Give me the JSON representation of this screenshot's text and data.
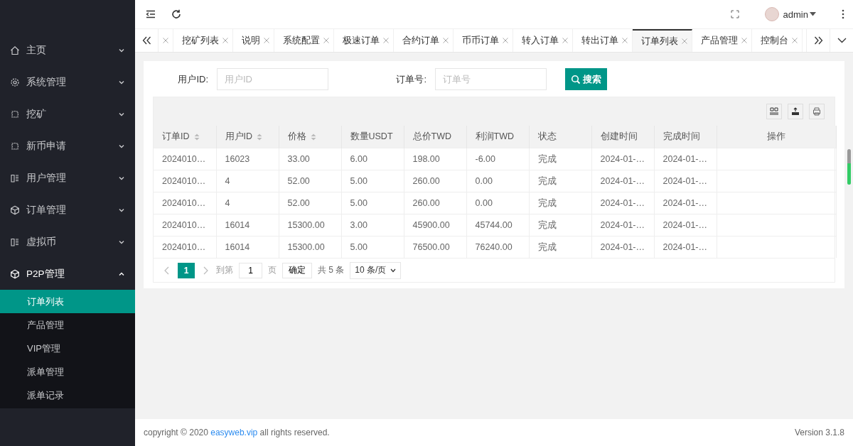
{
  "sidebar": {
    "items": [
      {
        "label": "主页",
        "expanded": false
      },
      {
        "label": "系统管理",
        "expanded": false
      },
      {
        "label": "挖矿",
        "expanded": false
      },
      {
        "label": "新币申请",
        "expanded": false
      },
      {
        "label": "用户管理",
        "expanded": false
      },
      {
        "label": "订单管理",
        "expanded": false
      },
      {
        "label": "虚拟币",
        "expanded": false
      },
      {
        "label": "P2P管理",
        "expanded": true,
        "children": [
          {
            "label": "订单列表",
            "selected": true
          },
          {
            "label": "产品管理",
            "selected": false
          },
          {
            "label": "VIP管理",
            "selected": false
          },
          {
            "label": "派单管理",
            "selected": false
          },
          {
            "label": "派单记录",
            "selected": false
          }
        ]
      }
    ]
  },
  "header": {
    "user": "admin"
  },
  "tabs": [
    {
      "selected": false
    },
    {
      "label": "挖矿列表",
      "selected": false
    },
    {
      "label": "说明",
      "selected": false
    },
    {
      "label": "系统配置",
      "selected": false
    },
    {
      "label": "极速订单",
      "selected": false
    },
    {
      "label": "合约订单",
      "selected": false
    },
    {
      "label": "币币订单",
      "selected": false
    },
    {
      "label": "转入订单",
      "selected": false
    },
    {
      "label": "转出订单",
      "selected": false
    },
    {
      "label": "订单列表",
      "selected": true
    },
    {
      "label": "产品管理",
      "selected": false
    },
    {
      "label": "控制台",
      "selected": false
    }
  ],
  "search": {
    "fields": [
      {
        "label": "用户ID:",
        "placeholder": "用户ID"
      },
      {
        "label": "订单号:",
        "placeholder": "订单号"
      }
    ],
    "button": "搜索"
  },
  "table": {
    "columns": [
      {
        "label": "订单ID",
        "sortable": true
      },
      {
        "label": "用户ID",
        "sortable": true
      },
      {
        "label": "价格",
        "sortable": true
      },
      {
        "label": "数量USDT",
        "sortable": false
      },
      {
        "label": "总价TWD",
        "sortable": false
      },
      {
        "label": "利润TWD",
        "sortable": false
      },
      {
        "label": "状态",
        "sortable": false
      },
      {
        "label": "创建时间",
        "sortable": false
      },
      {
        "label": "完成时间",
        "sortable": false
      },
      {
        "label": "操作",
        "sortable": false
      }
    ],
    "rows": [
      [
        "2024010…",
        "16023",
        "33.00",
        "6.00",
        "198.00",
        "-6.00",
        "完成",
        "2024-01-…",
        "2024-01-…"
      ],
      [
        "2024010…",
        "4",
        "52.00",
        "5.00",
        "260.00",
        "0.00",
        "完成",
        "2024-01-…",
        "2024-01-…"
      ],
      [
        "2024010…",
        "4",
        "52.00",
        "5.00",
        "260.00",
        "0.00",
        "完成",
        "2024-01-…",
        "2024-01-…"
      ],
      [
        "2024010…",
        "16014",
        "15300.00",
        "3.00",
        "45900.00",
        "45744.00",
        "完成",
        "2024-01-…",
        "2024-01-…"
      ],
      [
        "2024010…",
        "16014",
        "15300.00",
        "5.00",
        "76500.00",
        "76240.00",
        "完成",
        "2024-01-…",
        "2024-01-…"
      ]
    ]
  },
  "pagination": {
    "pages": [
      {
        "label": "1",
        "selected": true
      }
    ],
    "goto_label": "到第",
    "goto_value": "1",
    "page_unit": "页",
    "confirm": "确定",
    "total": "共 5 条",
    "page_size": "10 条/页"
  },
  "footer": {
    "copyright_before": "copyright © 2020 ",
    "link": "easyweb.vip",
    "copyright_after": " all rights reserved.",
    "version": "Version 3.1.8"
  }
}
